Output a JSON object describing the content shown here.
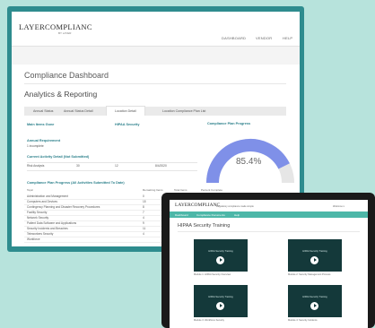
{
  "colors": {
    "background": "#b7e3dc",
    "monitor_frame": "#2e8c8e",
    "accent_teal": "#4db7a8",
    "gauge_fill": "#7f90e8",
    "gauge_track": "#e6e6e6",
    "laptop_frame": "#1a1a1a",
    "video_bg": "#14393a"
  },
  "desktop": {
    "logo": "LAYERCOMPLIANC",
    "logo_sub": "BY LAYER",
    "nav": [
      "DASHBOARD",
      "VENDOR",
      "HELP"
    ],
    "page_title": "Compliance Dashboard",
    "subtitle": "Analytics & Reporting",
    "tabs": [
      "Annual Status",
      "Annual Status Detail",
      "Location Detail",
      "Location Compliance Plan List"
    ],
    "active_tab": 2,
    "main_items_title": "Main Items Gone",
    "hipaa_title": "HIPAA Security",
    "annual_req_title": "Annual Requirement",
    "annual_req_value": "1 incomplete",
    "activity_title": "Current Activity Detail (Not Submitted)",
    "activity_row": [
      "Risk Analysis",
      "30",
      "12",
      "8/4/2020"
    ],
    "gauge": {
      "title": "Compliance Plan Progress",
      "value_label": "85.4%",
      "percent": 85.4
    },
    "plan_title": "Compliance Plan Progress (All Activities Submitted To Date)",
    "table_headers": [
      "Topic",
      "Remaining Items",
      "Total Items",
      "Percent Complete"
    ],
    "table_rows": [
      [
        "Administration and Management",
        "0",
        "17",
        "94.1 %"
      ],
      [
        "Computers and Devices",
        "15",
        "",
        ""
      ],
      [
        "Contingency Planning and Disaster Recovery Procedures",
        "8",
        "",
        ""
      ],
      [
        "Facility Security",
        "7",
        "",
        ""
      ],
      [
        "Network Security",
        "4",
        "",
        ""
      ],
      [
        "Patient Data Software and Applications",
        "9",
        "",
        ""
      ],
      [
        "Security Incidents and Breaches",
        "11",
        "",
        ""
      ],
      [
        "Teleworkers Security",
        "4",
        "",
        ""
      ],
      [
        "Workforce",
        "",
        "",
        ""
      ]
    ]
  },
  "laptop": {
    "logo": "LAYERCOMPLIANC",
    "header_text": "Regulatory compliance made simple",
    "right_text": "Welcome ▾",
    "nav": [
      "Dashboard",
      "Compliance Documents",
      "Help"
    ],
    "title": "HIPAA Security Training",
    "videos": [
      {
        "screen_text": "HIPAA Security Training",
        "caption": "Module 1: HIPAA Security Overview"
      },
      {
        "screen_text": "HIPAA Security Training",
        "caption": "Module 2: Security Management Process"
      },
      {
        "screen_text": "HIPAA Security Training",
        "caption": "Module 3: Workforce Security"
      },
      {
        "screen_text": "HIPAA Security Training",
        "caption": "Module 4: Security Incidents"
      }
    ]
  }
}
